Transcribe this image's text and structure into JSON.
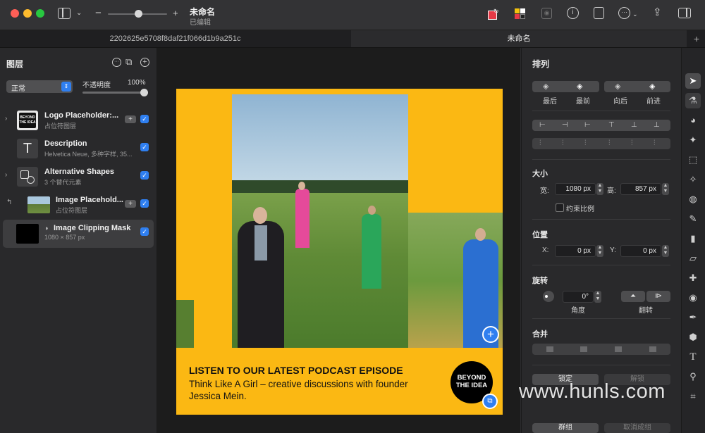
{
  "window": {
    "title": "未命名",
    "subtitle": "已编辑"
  },
  "tabs": [
    {
      "label": "2202625e5708f8daf21f066d1b9a251c"
    },
    {
      "label": "未命名"
    }
  ],
  "new_tab_label": "+",
  "layers_panel": {
    "title": "图层",
    "blend_mode": "正常",
    "opacity_label": "不透明度",
    "opacity_value": "100%",
    "layers": [
      {
        "name": "Logo Placeholder:...",
        "sub": "占位符图层",
        "thumb": "BEYOND THE IDEA",
        "has_plus": true,
        "expandable": true
      },
      {
        "name": "Description",
        "sub": "Helvetica Neue, 多种字样, 35...",
        "thumb": "T",
        "has_plus": false,
        "expandable": false
      },
      {
        "name": "Alternative Shapes",
        "sub": "3 个替代元素",
        "thumb": "shapes",
        "has_plus": false,
        "expandable": true
      },
      {
        "name": "Image Placehold...",
        "sub": "占位符图层",
        "thumb": "photo",
        "has_plus": true,
        "expandable": false
      },
      {
        "name": "Image Clipping Mask",
        "sub": "1080 × 857 px",
        "thumb": "black",
        "has_plus": false,
        "expandable": false
      }
    ]
  },
  "artwork": {
    "headline": "LISTEN TO OUR LATEST PODCAST EPISODE",
    "body_line1": "Think Like A Girl – creative discussions with founder",
    "body_line2": "Jessica Mein.",
    "logo_line1": "BEYOND",
    "logo_line2": "THE IDEA",
    "yellow": "#fbb813"
  },
  "arrange_panel": {
    "title": "排列",
    "order_labels": [
      "最后",
      "最前",
      "向后",
      "前进"
    ],
    "size_title": "大小",
    "width_label": "宽:",
    "width_value": "1080 px",
    "height_label": "高:",
    "height_value": "857 px",
    "constrain_label": "约束比例",
    "position_title": "位置",
    "x_label": "X:",
    "x_value": "0 px",
    "y_label": "Y:",
    "y_value": "0 px",
    "rotate_title": "旋转",
    "angle_value": "0°",
    "angle_label": "角度",
    "flip_label": "翻转",
    "combine_title": "合并",
    "lock_label": "锁定",
    "unlock_label": "解锁",
    "group_label": "群组",
    "ungroup_label": "取消成组"
  },
  "watermark": "www.hunls.com",
  "accent": "#2f7ff0"
}
